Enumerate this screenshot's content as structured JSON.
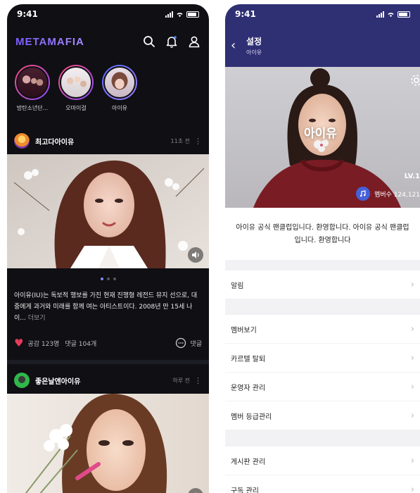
{
  "left": {
    "status_time": "9:41",
    "logo": "METAMAFIA",
    "icons": [
      "search-icon",
      "bell-icon",
      "person-icon"
    ],
    "stories": [
      {
        "name": "방탄소년단..."
      },
      {
        "name": "오마이걸"
      },
      {
        "name": "아이유"
      }
    ],
    "post1": {
      "user": "최고다아이유",
      "time": "11초 전",
      "caption": "아이유(IU)는 독보적 행보를 가진 현재 진행형 레전드 뮤지 선으로, 대중에게 과거와 미래를 함께 여는 아티스트이다. 2008년 만 15세 나이...",
      "more": "더보기",
      "likes": "공감 123명",
      "comments": "댓글 104개",
      "comment_btn": "댓글"
    },
    "post2": {
      "user": "좋은날엔아이유",
      "time": "하루 전"
    }
  },
  "right": {
    "status_time": "9:41",
    "title": "설정",
    "subtitle": "아이유",
    "cover_name": "아이유",
    "level": "LV.1",
    "members": "멤버수 124,121",
    "intro": "아이유 공식 팬클럽입니다. 환영합니다. 아이유 공식 팬클럽입니다. 환영합니다",
    "menu": {
      "alarm": "알림",
      "members_view": "멤버보기",
      "leave": "카르텔 탈퇴",
      "admin": "운영자 관리",
      "grade": "멤버 등급관리",
      "board": "게시판 관리",
      "subscribe": "구독 관리"
    }
  },
  "colors": {
    "accent": "#7b5cff",
    "header": "#2f2f74",
    "dark_bg": "#0f0f14",
    "heart": "#e53b5a"
  }
}
